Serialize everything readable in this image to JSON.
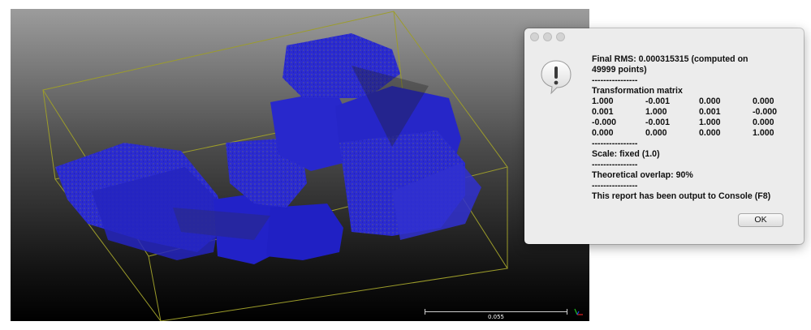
{
  "viewer": {
    "scale_label": "0.055",
    "colors": {
      "point_cloud": "#2b2bd8",
      "bounding_box": "#9c9c2a"
    }
  },
  "dialog": {
    "rms_line_1": "Final RMS: 0.000315315 (computed on",
    "rms_line_2": "49999 points)",
    "separator": "----------------",
    "matrix_title": "Transformation matrix",
    "matrix": [
      [
        "1.000",
        "-0.001",
        "0.000",
        "0.000"
      ],
      [
        "0.001",
        "1.000",
        "0.001",
        "-0.000"
      ],
      [
        "-0.000",
        "-0.001",
        "1.000",
        "0.000"
      ],
      [
        "0.000",
        "0.000",
        "0.000",
        "1.000"
      ]
    ],
    "scale": "Scale: fixed (1.0)",
    "overlap": "Theoretical overlap: 90%",
    "console_note": "This report has been output to Console (F8)",
    "ok_label": "OK",
    "icon": "exclamation-alert-icon"
  }
}
